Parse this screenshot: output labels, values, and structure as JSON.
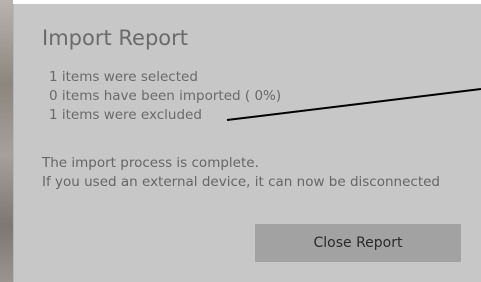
{
  "dialog": {
    "title": "Import Report",
    "summary": [
      "1 items were selected",
      "0 items have been imported ( 0%)",
      "1 items were excluded"
    ],
    "message": [
      "The import process is complete.",
      "If you used an external device, it can now be disconnected"
    ],
    "close_button_label": "Close Report"
  },
  "colors": {
    "dialog_background": "#c7c7c7",
    "button_background": "#a2a2a2",
    "text": "#6a6a6a",
    "annotation_line": "#000000"
  }
}
